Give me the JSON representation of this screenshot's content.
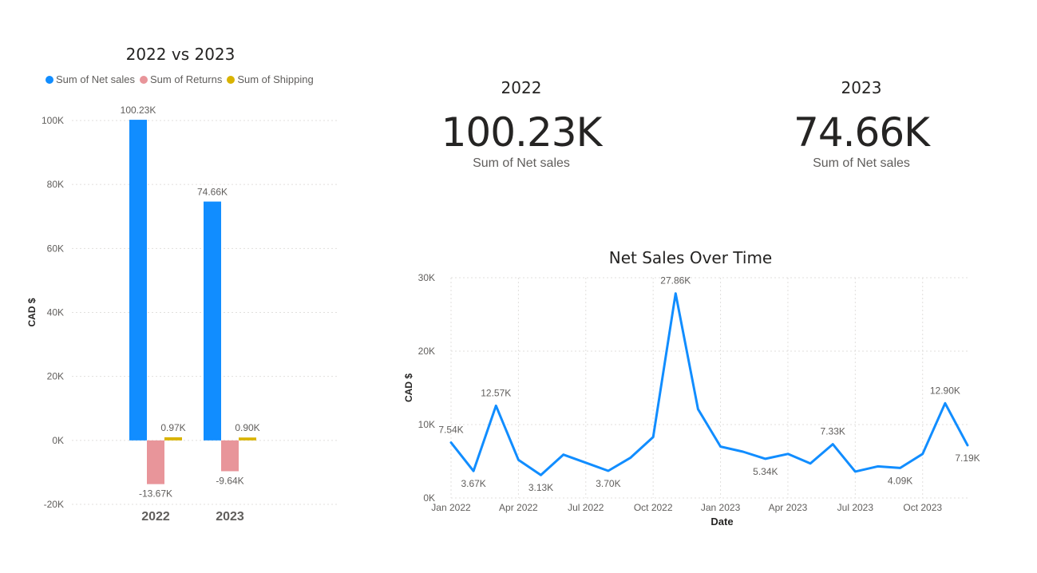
{
  "bar_panel": {
    "legend": [
      {
        "label": "Sum of Net sales",
        "color": "#118DFF"
      },
      {
        "label": "Sum of Returns",
        "color": "#E8959A"
      },
      {
        "label": "Sum of Shipping",
        "color": "#D9B300"
      }
    ]
  },
  "kpis": [
    {
      "year": "2022",
      "value": "100.23K",
      "label": "Sum of Net sales"
    },
    {
      "year": "2023",
      "value": "74.66K",
      "label": "Sum of Net sales"
    }
  ],
  "chart_data": [
    {
      "type": "bar",
      "title": "2022 vs 2023",
      "xlabel": "",
      "ylabel": "CAD $",
      "categories": [
        "2022",
        "2023"
      ],
      "ylim": [
        -20000,
        100000
      ],
      "yticks": [
        -20000,
        0,
        20000,
        40000,
        60000,
        80000,
        100000
      ],
      "ytick_labels": [
        "-20K",
        "0K",
        "20K",
        "40K",
        "60K",
        "80K",
        "100K"
      ],
      "grid": true,
      "legend_position": "top-left",
      "series": [
        {
          "name": "Sum of Net sales",
          "color": "#118DFF",
          "values": [
            100230,
            74660
          ],
          "labels": [
            "100.23K",
            "74.66K"
          ]
        },
        {
          "name": "Sum of Returns",
          "color": "#E8959A",
          "values": [
            -13670,
            -9640
          ],
          "labels": [
            "-13.67K",
            "-9.64K"
          ]
        },
        {
          "name": "Sum of Shipping",
          "color": "#D9B300",
          "values": [
            970,
            900
          ],
          "labels": [
            "0.97K",
            "0.90K"
          ]
        }
      ]
    },
    {
      "type": "line",
      "title": "Net Sales Over Time",
      "xlabel": "Date",
      "ylabel": "CAD $",
      "x": [
        "2022-01",
        "2022-02",
        "2022-03",
        "2022-04",
        "2022-05",
        "2022-06",
        "2022-07",
        "2022-08",
        "2022-09",
        "2022-10",
        "2022-11",
        "2022-12",
        "2023-01",
        "2023-02",
        "2023-03",
        "2023-04",
        "2023-05",
        "2023-06",
        "2023-07",
        "2023-08",
        "2023-09",
        "2023-10",
        "2023-11",
        "2023-12"
      ],
      "ylim": [
        0,
        30000
      ],
      "yticks": [
        0,
        10000,
        20000,
        30000
      ],
      "ytick_labels": [
        "0K",
        "10K",
        "20K",
        "30K"
      ],
      "xticks": [
        "2022-01",
        "2022-04",
        "2022-07",
        "2022-10",
        "2023-01",
        "2023-04",
        "2023-07",
        "2023-10"
      ],
      "xtick_labels": [
        "Jan 2022",
        "Apr 2022",
        "Jul 2022",
        "Oct 2022",
        "Jan 2023",
        "Apr 2023",
        "Jul 2023",
        "Oct 2023"
      ],
      "grid": true,
      "series": [
        {
          "name": "Net sales",
          "color": "#118DFF",
          "values": [
            7540,
            3670,
            12570,
            5200,
            3130,
            5900,
            4800,
            3700,
            5500,
            8300,
            27860,
            12100,
            7000,
            6300,
            5340,
            6000,
            4700,
            7330,
            3600,
            4300,
            4090,
            6000,
            12900,
            7190
          ],
          "point_labels": [
            {
              "index": 0,
              "text": "7.54K",
              "pos": "above"
            },
            {
              "index": 1,
              "text": "3.67K",
              "pos": "below"
            },
            {
              "index": 2,
              "text": "12.57K",
              "pos": "above"
            },
            {
              "index": 4,
              "text": "3.13K",
              "pos": "below"
            },
            {
              "index": 7,
              "text": "3.70K",
              "pos": "below"
            },
            {
              "index": 10,
              "text": "27.86K",
              "pos": "above"
            },
            {
              "index": 14,
              "text": "5.34K",
              "pos": "below"
            },
            {
              "index": 17,
              "text": "7.33K",
              "pos": "above"
            },
            {
              "index": 20,
              "text": "4.09K",
              "pos": "below"
            },
            {
              "index": 22,
              "text": "12.90K",
              "pos": "above"
            },
            {
              "index": 23,
              "text": "7.19K",
              "pos": "below"
            }
          ]
        }
      ]
    }
  ]
}
